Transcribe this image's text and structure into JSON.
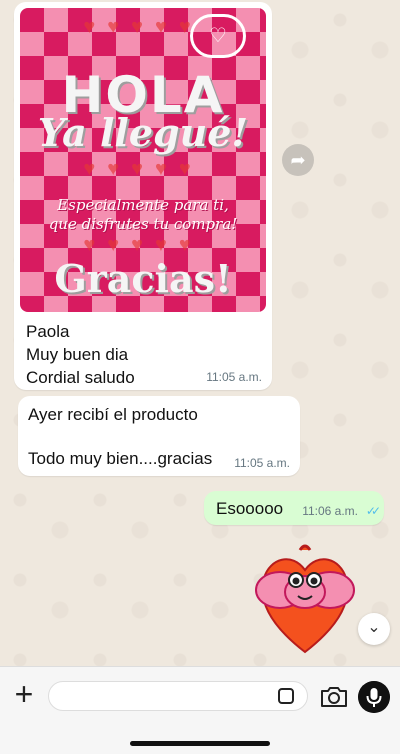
{
  "messages": {
    "image_message": {
      "poster": {
        "hola": "HOLA",
        "llegue": "Ya llegué!",
        "especial_line1": "Especialmente para ti,",
        "especial_line2": "que disfrutes tu compra!",
        "gracias": "Gracias!"
      },
      "caption_lines": [
        "Paola",
        "Muy buen dia",
        "Cordial saludo"
      ],
      "time": "11:05 a.m."
    },
    "text_message": {
      "line1": "Ayer recibí el producto",
      "line2": "Todo muy bien....gracias",
      "time": "11:05 a.m."
    },
    "outgoing_message": {
      "text": "Esooooo",
      "time": "11:06 a.m.",
      "status": "read"
    }
  },
  "icons": {
    "forward": "forward-icon",
    "scroll_down": "chevron-down-icon",
    "add": "plus-icon",
    "sticker": "sticker-icon",
    "camera": "camera-icon",
    "mic": "microphone-icon"
  },
  "input": {
    "placeholder": "",
    "value": ""
  },
  "colors": {
    "outgoing_bubble": "#d9fdd3",
    "incoming_bubble": "#ffffff",
    "read_ticks": "#53bdeb",
    "wallpaper": "#efeae2"
  }
}
